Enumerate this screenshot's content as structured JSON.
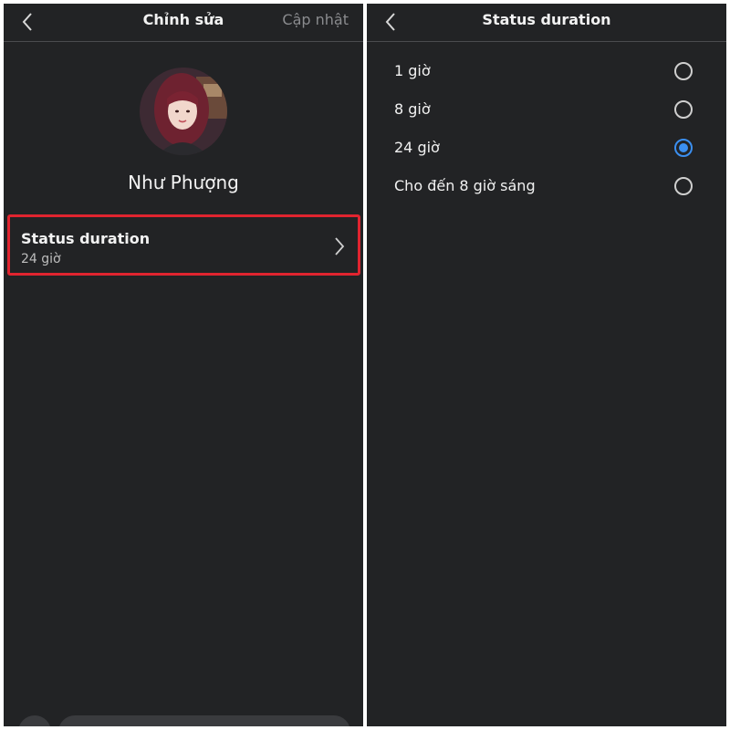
{
  "left_screen": {
    "header": {
      "title": "Chỉnh sửa",
      "update_label": "Cập nhật",
      "back_icon": "chevron-left-icon"
    },
    "profile": {
      "name": "Như Phượng",
      "avatar": "avatar"
    },
    "status_row": {
      "title": "Status duration",
      "value": "24 giờ",
      "chevron_icon": "chevron-right-icon",
      "highlight_color": "#e0242f"
    }
  },
  "right_screen": {
    "header": {
      "title": "Status duration",
      "back_icon": "chevron-left-icon"
    },
    "options": [
      {
        "label": "1 giờ",
        "selected": false
      },
      {
        "label": "8 giờ",
        "selected": false
      },
      {
        "label": "24 giờ",
        "selected": true
      },
      {
        "label": "Cho đến 8 giờ sáng",
        "selected": false
      }
    ]
  },
  "colors": {
    "background": "#222325",
    "accent": "#3b8ff0",
    "text": "#f2f2f2",
    "muted": "#8a8b8e"
  }
}
